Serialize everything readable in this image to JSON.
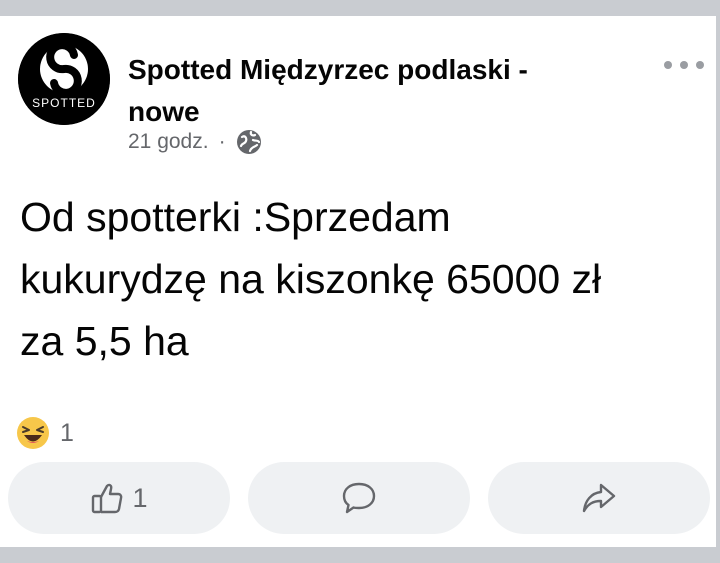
{
  "post": {
    "author": "Spotted Międzyrzec podlaski - nowe",
    "avatar_text": "SPOTTED",
    "time": "21 godz.",
    "separator": "·",
    "privacy_icon": "globe-icon",
    "more_icon": "more-options-icon",
    "text_lines": [
      "Od spotterki :Sprzedam",
      "kukurydzę na kiszonkę 65000 zł",
      "za 5,5 ha"
    ]
  },
  "reactions": {
    "emoji": "laughing-emoji-icon",
    "count": "1"
  },
  "actions": {
    "like": {
      "icon": "thumbs-up-icon",
      "count": "1"
    },
    "comment": {
      "icon": "comment-icon"
    },
    "share": {
      "icon": "share-icon"
    }
  },
  "colors": {
    "text": "#050505",
    "secondary": "#65676b",
    "button_bg": "#eff1f3",
    "frame": "#c9ccd1"
  }
}
